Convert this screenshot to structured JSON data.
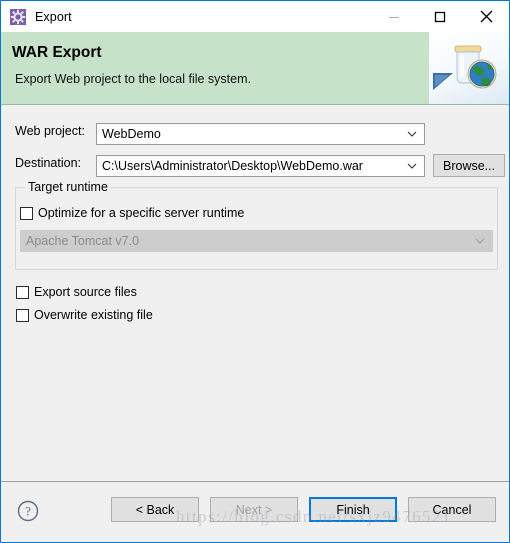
{
  "window": {
    "title": "Export",
    "icon": "export-wizard-icon",
    "accent_color": "#0078d7",
    "controls": {
      "minimize": "minimize-icon",
      "maximize": "maximize-icon",
      "close": "close-icon"
    }
  },
  "banner": {
    "heading": "WAR Export",
    "description": "Export Web project to the local file system.",
    "background_color": "#c6e3ca",
    "graphic": "war-jar-globe-icon"
  },
  "form": {
    "web_project": {
      "label": "Web project:",
      "value": "WebDemo"
    },
    "destination": {
      "label": "Destination:",
      "value": "C:\\Users\\Administrator\\Desktop\\WebDemo.war",
      "browse_label": "Browse..."
    },
    "target_runtime": {
      "legend": "Target runtime",
      "optimize_label": "Optimize for a specific server runtime",
      "optimize_checked": false,
      "runtime_value": "Apache Tomcat v7.0",
      "runtime_disabled": true
    },
    "options": [
      {
        "label": "Export source files",
        "checked": false
      },
      {
        "label": "Overwrite existing file",
        "checked": false
      }
    ]
  },
  "footer": {
    "help": "help-icon",
    "buttons": [
      {
        "label": "< Back",
        "state": "enabled"
      },
      {
        "label": "Next >",
        "state": "disabled"
      },
      {
        "label": "Finish",
        "state": "default"
      },
      {
        "label": "Cancel",
        "state": "enabled"
      }
    ]
  },
  "watermark": {
    "text": "https://blog.csdn.net/sxjz9476521"
  }
}
